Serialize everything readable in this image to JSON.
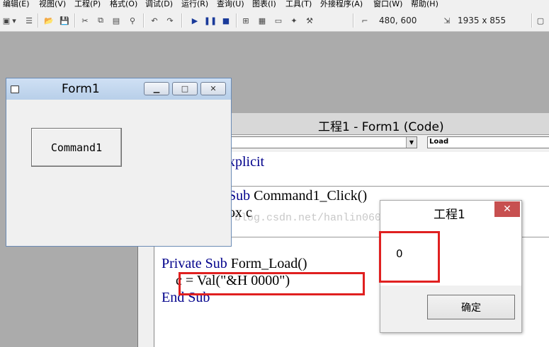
{
  "menu": [
    "编辑(E)",
    "视图(V)",
    "工程(P)",
    "格式(O)",
    "调试(D)",
    "运行(R)",
    "查询(U)",
    "图表(I)",
    "工具(T)",
    "外接程序(A)",
    "窗口(W)",
    "帮助(H)"
  ],
  "toolbar": {
    "position": "480, 600",
    "size": "1935 x 855"
  },
  "form1": {
    "title": "Form1",
    "button_label": "Command1"
  },
  "code_window": {
    "title": "工程1 - Form1 (Code)",
    "proc_combo": "Load",
    "watermark": "http://blog.csdn.net/hanlin0605",
    "lines": {
      "l1": "xplicit",
      "l2_kw": "Sub",
      "l2": " Command1_Click()",
      "l3": "ox c",
      "l4_kw": "Private Sub",
      "l4": " Form_Load()",
      "l5": "    c = Val(\"&H 0000\")",
      "l6_kw": "End Sub"
    }
  },
  "msgbox": {
    "title": "工程1",
    "message": "0",
    "ok_label": "确定",
    "close_glyph": "✕"
  },
  "colors": {
    "highlight_red": "#e02020",
    "keyword_blue": "#00008b",
    "close_red": "#c75050"
  }
}
